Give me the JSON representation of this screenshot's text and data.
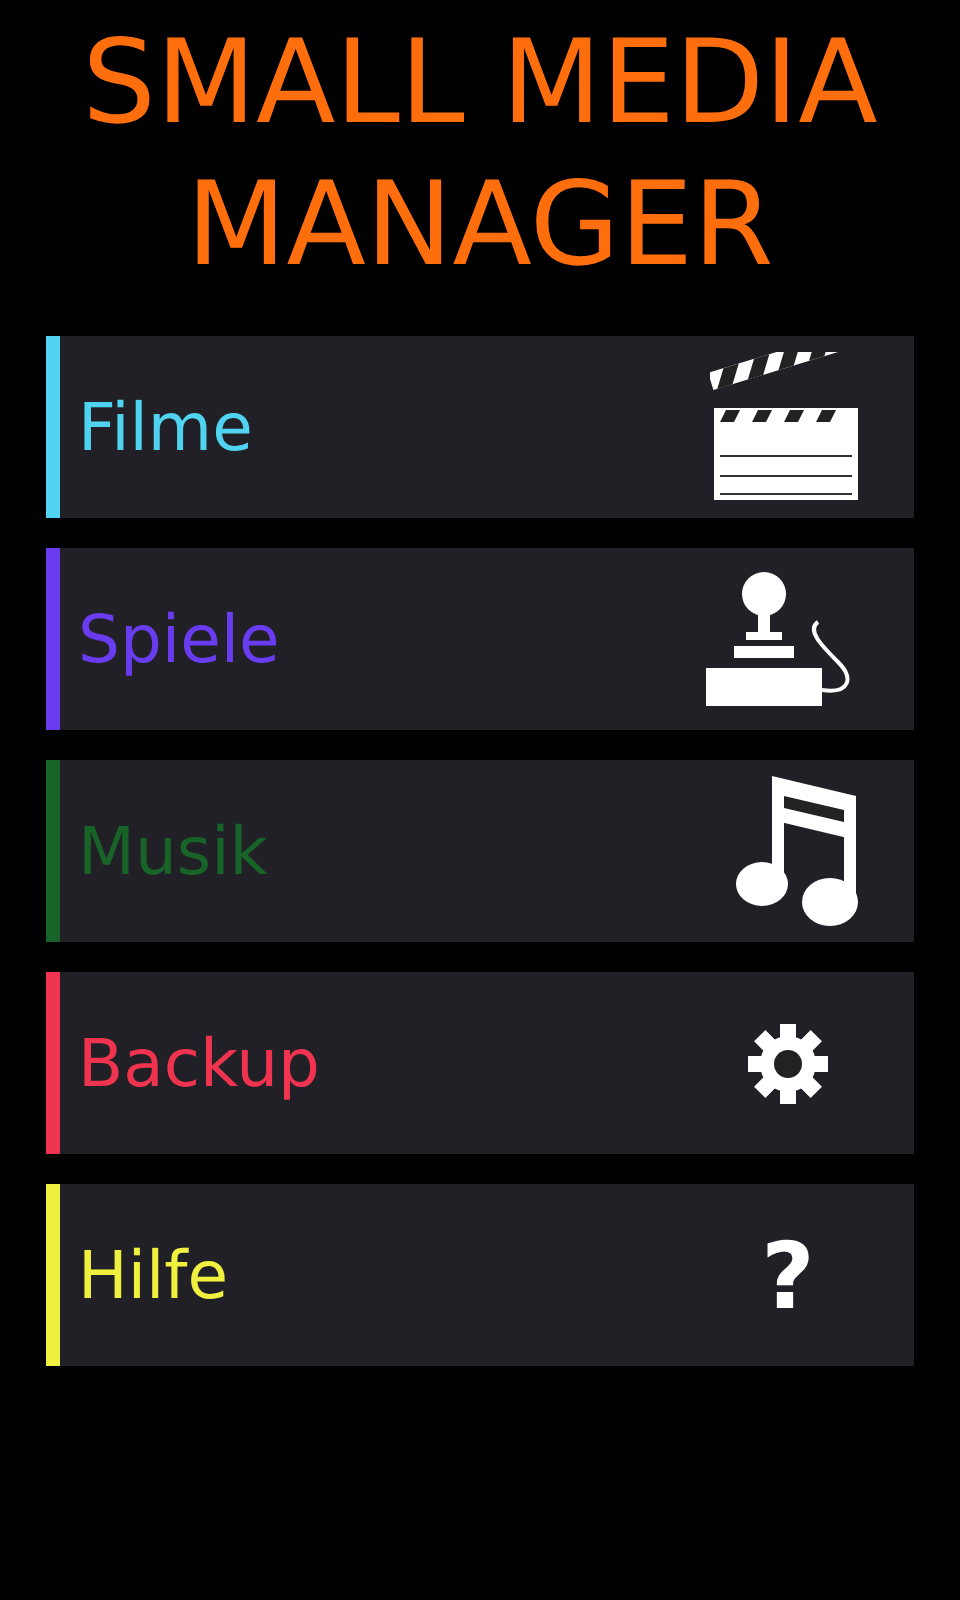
{
  "title": "SMALL MEDIA MANAGER",
  "menu": [
    {
      "label": "Filme",
      "color": "#4fd3f0",
      "kind": "clapperboard"
    },
    {
      "label": "Spiele",
      "color": "#6a3cf0",
      "kind": "joystick"
    },
    {
      "label": "Musik",
      "color": "#186428",
      "kind": "music"
    },
    {
      "label": "Backup",
      "color": "#f0344f",
      "kind": "gear"
    },
    {
      "label": "Hilfe",
      "color": "#f0f040",
      "kind": "text",
      "icon_text": "?"
    }
  ]
}
